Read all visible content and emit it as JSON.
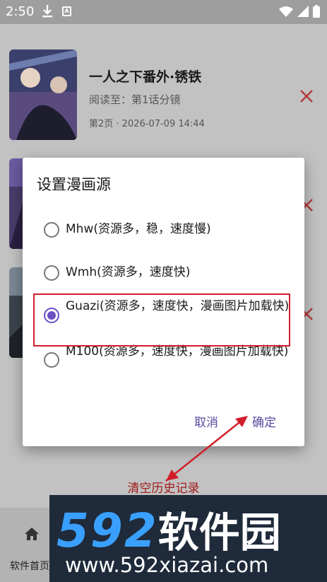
{
  "status_bar": {
    "time": "2:50",
    "icons": [
      "download-icon",
      "a-badge-icon",
      "wifi-icon",
      "signal-icon",
      "battery-icon"
    ]
  },
  "history": {
    "items": [
      {
        "title": "一人之下番外·锈铁",
        "read": "阅读至：第1话分镜",
        "meta": "第2页 · 2026-07-09 14:44"
      },
      {
        "title": "",
        "read": "",
        "meta": ""
      },
      {
        "title": "",
        "read": "",
        "meta": ""
      }
    ],
    "clear_label": "清空历史记录"
  },
  "bottom_nav": {
    "home_label": "软件首页"
  },
  "watermark": {
    "logo_num": "592",
    "logo_cn": "软件园",
    "url": "www.592xiazai.com"
  },
  "dialog": {
    "title": "设置漫画源",
    "options": [
      {
        "label": "Mhw(资源多，稳，速度慢)",
        "checked": false
      },
      {
        "label": "Wmh(资源多，速度快)",
        "checked": false
      },
      {
        "label": "Guazi(资源多，速度快，漫画图片加载快)",
        "checked": true
      },
      {
        "label": "M100(资源多，速度快，漫画图片加载快)",
        "checked": false
      }
    ],
    "cancel_label": "取消",
    "confirm_label": "确定"
  },
  "colors": {
    "accent": "#6b4fc4",
    "highlight": "#d11f2a",
    "delete": "#c62828"
  }
}
